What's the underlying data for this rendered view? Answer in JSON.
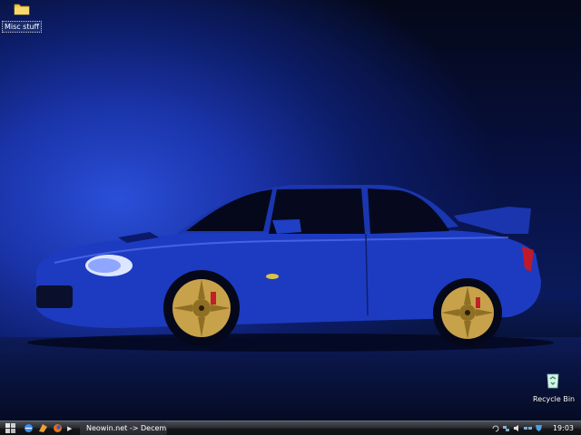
{
  "desktop": {
    "icons": [
      {
        "label": "Misc stuff",
        "icon": "folder-icon"
      },
      {
        "label": "Recycle Bin",
        "icon": "recycle-bin-icon"
      }
    ],
    "wallpaper": {
      "subject": "blue sedan on dark blue background",
      "colors": {
        "body": "#1f3fc4",
        "wheels": "#c8a24a",
        "background": "#0a1a5a"
      }
    }
  },
  "taskbar": {
    "start_icon": "windows-logo-icon",
    "quick_launch": [
      "ie-icon",
      "media-icon",
      "firefox-icon"
    ],
    "task": {
      "label": "Neowin.net -> Decem..",
      "icon": "firefox-icon"
    },
    "tray_icons": [
      "arrow-icon",
      "network-icon",
      "volume-icon",
      "network-icon",
      "shield-icon"
    ],
    "clock": "19:03"
  }
}
